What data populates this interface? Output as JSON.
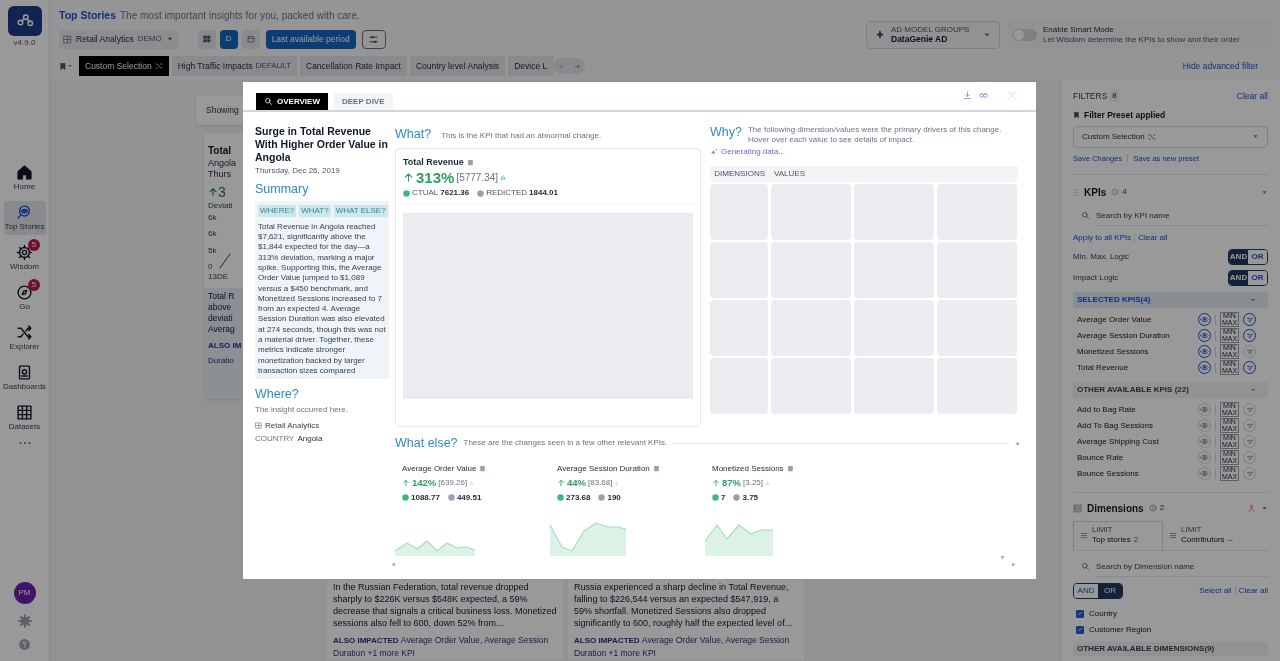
{
  "app": {
    "version": "v4.9.0"
  },
  "nav": [
    {
      "label": "Home",
      "kind": "home",
      "selected": false
    },
    {
      "label": "Top Stories",
      "kind": "stories",
      "selected": true
    },
    {
      "label": "Wisdom",
      "kind": "wisdom",
      "selected": false,
      "badge": "5"
    },
    {
      "label": "Go",
      "kind": "go",
      "selected": false,
      "badge": "5"
    },
    {
      "label": "Explorer",
      "kind": "explorer",
      "selected": false
    },
    {
      "label": "Dashboards",
      "kind": "dashboards",
      "selected": false
    },
    {
      "label": "Datasets",
      "kind": "datasets",
      "selected": false
    }
  ],
  "user": {
    "initials": "PM"
  },
  "header": {
    "title": "Top Stories",
    "subtitle": "The most important insights for you, packed with care.",
    "dataset": {
      "label": "Retail Analytics",
      "badge": "DEMO"
    },
    "view_modes": [
      {
        "kind": "grid",
        "selected": false
      },
      {
        "kind": "text",
        "label": "D",
        "selected": true
      },
      {
        "kind": "calendar",
        "selected": false
      }
    ],
    "period": "Last available period",
    "model_group": {
      "label": "AD MODEL GROUPS",
      "value": "DataGenie AD"
    },
    "smart_mode": {
      "label": "Enable Smart Mode",
      "description": "Let Wisdom determine the KPIs to show and their order",
      "on": false
    }
  },
  "presets": {
    "tabs": [
      {
        "label": "Custom Selection",
        "kind": "custom",
        "selected": true
      },
      {
        "label": "High Traffic Impacts",
        "kind": "default",
        "badge": "DEFAULT",
        "selected": false
      },
      {
        "label": "Cancellation Rate Impact",
        "kind": "plain",
        "selected": false
      },
      {
        "label": "Country level Analysis",
        "kind": "plain",
        "selected": false
      },
      {
        "label": "Device L",
        "kind": "plain",
        "selected": false
      }
    ],
    "hide_filter": "Hide advanced filter"
  },
  "background": {
    "showing": "Showing",
    "peek": {
      "title": "Total",
      "lines": [
        "Angola",
        "Thurs"
      ],
      "change": "3",
      "change_label": "Deviati",
      "ticks": [
        "6k",
        "6k",
        "5k",
        "0"
      ],
      "x_label": "13DE",
      "summary_lines": [
        "Total R",
        "above",
        "deviati",
        "Averag"
      ],
      "also_label": "ALSO IM",
      "also_value": "Duratio"
    },
    "cards": [
      {
        "summary": "In the Russian Federation, total revenue dropped sharply to $226K versus $548K expected, a 59% decrease that signals a critical business loss. Monetized sessions also fell to 600, down 52% from...",
        "also_label": "ALSO IMPACTED",
        "also_value": "Average Order Value, Average Session Duration +1 more KPI"
      },
      {
        "summary": "Russia experienced a sharp decline in Total Revenue, falling to $226,544 versus an expected $547,919, a 59% shortfall. Monetized Sessions also dropped significantly to 600, roughly half the expected level of...",
        "also_label": "ALSO IMPACTED",
        "also_value": "Average Order Value, Average Session Duration +1 more KPI"
      }
    ]
  },
  "modal": {
    "tabs": [
      {
        "label": "OVERVIEW",
        "selected": true
      },
      {
        "label": "DEEP DIVE",
        "selected": false
      }
    ],
    "title": "Surge in Total Revenue With Higher Order Value in Angola",
    "date": "Thursday, Dec 26, 2019",
    "summary_heading": "Summary",
    "chips": [
      "WHERE?",
      "WHAT?",
      "WHAT ELSE?"
    ],
    "summary": "Total Revenue in Angola reached $7,621, significantly above the $1,844 expected for the day—a 313% deviation, marking a major spike. Supporting this, the Average Order Value jumped to $1,089 versus a $450 benchmark, and Monetized Sessions increased to 7 from an expected 4. Average Session Duration was also elevated at 274 seconds, though this was not a material driver. Together, these metrics indicate stronger monetization backed by larger transaction sizes compared",
    "where": {
      "heading": "Where?",
      "description": "The insight occurred here.",
      "dataset": "Retail Analytics",
      "dimension": "COUNTRY",
      "value": "Angola"
    },
    "what": {
      "heading": "What?",
      "description": "This is the KPI that had an abnormal change.",
      "kpi": {
        "name": "Total Revenue",
        "change": "313%",
        "delta": "[5777.34]",
        "actual_label": "CTUAL",
        "actual": "7621.36",
        "predicted_label": "REDICTED",
        "predicted": "1844.01"
      }
    },
    "why": {
      "heading": "Why?",
      "description": "The following dimension/values were the primary drivers of this change. Hover over each value to see details of impact.",
      "status": "Generating data...",
      "columns": [
        "DIMENSIONS",
        "VALUES"
      ]
    },
    "what_else": {
      "heading": "What else?",
      "description": "These are the changes seen in a few other relevant KPIs.",
      "kpis": [
        {
          "name": "Average Order Value",
          "change": "142%",
          "delta": "[639.26]",
          "actual": "1088.77",
          "predicted": "449.51"
        },
        {
          "name": "Average Session Duration",
          "change": "44%",
          "delta": "[83.68]",
          "actual": "273.68",
          "predicted": "190"
        },
        {
          "name": "Monetized Sessions",
          "change": "87%",
          "delta": "[3.25]",
          "actual": "7",
          "predicted": "3.75"
        }
      ]
    }
  },
  "filters": {
    "title": "FILTERS",
    "count": "8",
    "clear": "Clear all",
    "preset_label": "Filter Preset applied",
    "preset_value": "Custom Selection",
    "save": "Save Changes",
    "save_new": "Save as new preset",
    "kpis": {
      "title": "KPIs",
      "count": "4",
      "search_placeholder": "Search by KPI name",
      "apply_all": "Apply to all KPIs",
      "clear": "Clear all",
      "logics": [
        {
          "label": "Min. Max. Logic",
          "options": [
            {
              "label": "AND",
              "selected": true
            },
            {
              "label": "OR",
              "selected": false
            }
          ]
        },
        {
          "label": "Impact Logic",
          "options": [
            {
              "label": "AND",
              "selected": true
            },
            {
              "label": "OR",
              "selected": false
            }
          ]
        }
      ],
      "groups": [
        {
          "title": "SELECTED KPIS(4)",
          "kind": "selected",
          "items": [
            {
              "name": "Average Order Value",
              "eye_on": true,
              "min_max": "MIN MAX",
              "filter_on": true
            },
            {
              "name": "Average Session Duration",
              "eye_on": true,
              "min_max": "MIN MAX",
              "filter_on": true
            },
            {
              "name": "Monetized Sessions",
              "eye_on": true,
              "min_max": "MIN MAX",
              "filter_on": false
            },
            {
              "name": "Total Revenue",
              "eye_on": true,
              "min_max": "MIN MAX",
              "filter_on": true
            }
          ]
        },
        {
          "title": "OTHER AVAILABLE KPIS (22)",
          "kind": "other",
          "items": [
            {
              "name": "Add to Bag Rate",
              "eye_on": false,
              "min_max": "MIN MAX",
              "filter_on": false
            },
            {
              "name": "Add To Bag Sessions",
              "eye_on": false,
              "min_max": "MIN MAX",
              "filter_on": false
            },
            {
              "name": "Average Shipping Cost",
              "eye_on": false,
              "min_max": "MIN MAX",
              "filter_on": false
            },
            {
              "name": "Bounce Rate",
              "eye_on": false,
              "min_max": "MIN MAX",
              "filter_on": false
            },
            {
              "name": "Bounce Sessions",
              "eye_on": false,
              "min_max": "MIN MAX",
              "filter_on": false
            }
          ]
        }
      ]
    },
    "dimensions": {
      "title": "Dimensions",
      "count": "2",
      "limits": [
        {
          "label": "LIMIT",
          "value": "Top stories",
          "count": "2",
          "selected": true
        },
        {
          "label": "LIMIT",
          "value": "Contributors",
          "count": "--",
          "selected": false
        }
      ],
      "search_placeholder": "Search by Dimension name",
      "logic": [
        {
          "label": "AND",
          "selected": false
        },
        {
          "label": "OR",
          "selected": true
        }
      ],
      "select_all": "Select all",
      "clear": "Clear all",
      "items": [
        {
          "name": "Country",
          "checked": true
        },
        {
          "name": "Customer Region",
          "checked": true
        }
      ],
      "other": "OTHER AVAILABLE DIMENSIONS(9)"
    }
  }
}
